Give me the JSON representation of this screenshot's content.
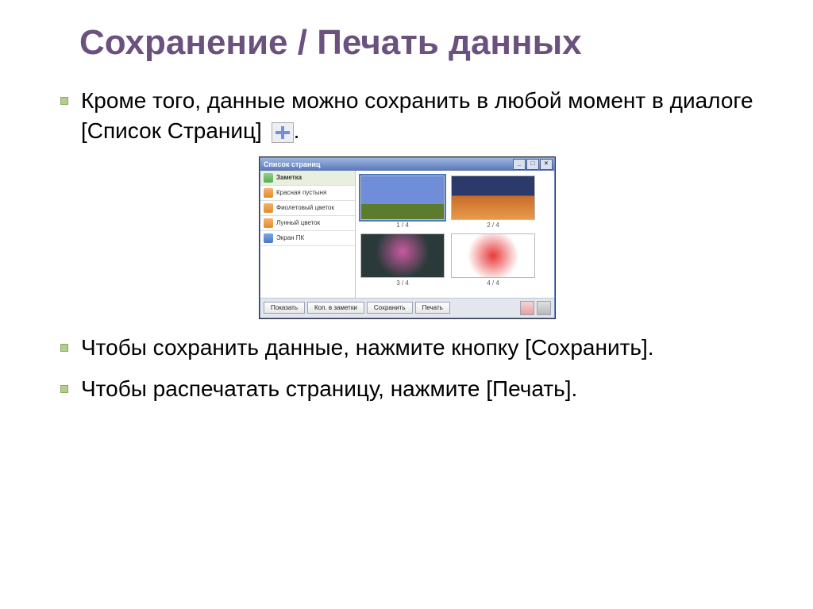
{
  "title": "Сохранение / Печать данных",
  "bullets": {
    "b1_pre": "Кроме того, данные можно сохранить в любой момент в диалоге [Список Страниц] ",
    "b1_post": ".",
    "b2": "Чтобы сохранить данные, нажмите кнопку [Сохранить].",
    "b3": "Чтобы распечатать страницу, нажмите [Печать]."
  },
  "dialog": {
    "title": "Список страниц",
    "sidebar": {
      "item0": "Заметка",
      "item1": "Красная пустыня",
      "item2": "Фиолетовый цветок",
      "item3": "Лунный цветок",
      "item4": "Экран ПК"
    },
    "thumbs": {
      "c1": "1 / 4",
      "c2": "2 / 4",
      "c3": "3 / 4",
      "c4": "4 / 4"
    },
    "buttons": {
      "show": "Показать",
      "copy": "Коп. в заметки",
      "save": "Сохранить",
      "print": "Печать"
    }
  }
}
